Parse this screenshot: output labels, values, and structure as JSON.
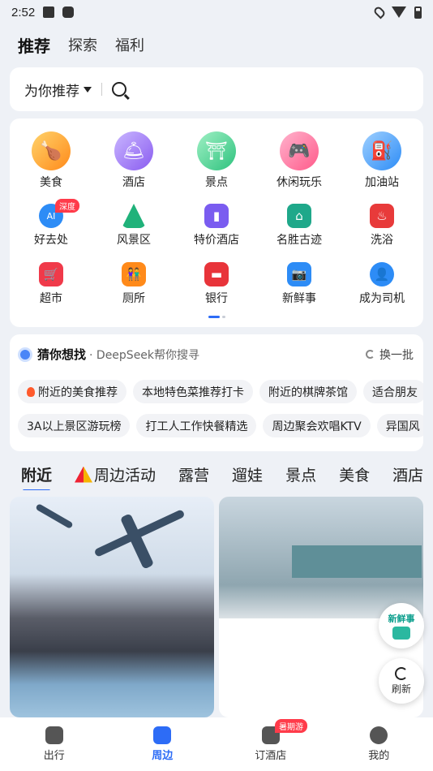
{
  "status": {
    "time": "2:52"
  },
  "top_tabs": [
    {
      "label": "推荐",
      "active": true
    },
    {
      "label": "探索",
      "active": false
    },
    {
      "label": "福利",
      "active": false
    }
  ],
  "search": {
    "selector_label": "为你推荐"
  },
  "grid": {
    "rows": [
      [
        {
          "label": "美食",
          "icon": "food-icon",
          "color": "#ff9a1f"
        },
        {
          "label": "酒店",
          "icon": "hotel-icon",
          "color": "#8a5cf0"
        },
        {
          "label": "景点",
          "icon": "scenic-icon",
          "color": "#2ec27e"
        },
        {
          "label": "休闲玩乐",
          "icon": "gamepad-icon",
          "color": "#ff5a8a"
        },
        {
          "label": "加油站",
          "icon": "gas-station-icon",
          "color": "#2d8cf6"
        }
      ],
      [
        {
          "label": "好去处",
          "icon": "ai-icon",
          "color": "#2d8cf6",
          "badge": "深度"
        },
        {
          "label": "风景区",
          "icon": "mountain-icon",
          "color": "#20b27a"
        },
        {
          "label": "特价酒店",
          "icon": "discount-hotel-icon",
          "color": "#7a5cf0"
        },
        {
          "label": "名胜古迹",
          "icon": "pagoda-icon",
          "color": "#1fa88a"
        },
        {
          "label": "洗浴",
          "icon": "bath-icon",
          "color": "#e83a3a"
        }
      ],
      [
        {
          "label": "超市",
          "icon": "cart-icon",
          "color": "#f03a4a"
        },
        {
          "label": "厕所",
          "icon": "toilet-icon",
          "color": "#ff8a1a"
        },
        {
          "label": "银行",
          "icon": "bank-card-icon",
          "color": "#e8343a"
        },
        {
          "label": "新鲜事",
          "icon": "news-camera-icon",
          "color": "#2d8cf6"
        },
        {
          "label": "成为司机",
          "icon": "driver-icon",
          "color": "#2d8cf6"
        }
      ]
    ]
  },
  "guess": {
    "title": "猜你想找",
    "subtitle": "· DeepSeek帮你搜寻",
    "refresh_label": "换一批",
    "chips_row1": [
      "附近的美食推荐",
      "本地特色菜推荐打卡",
      "附近的棋牌茶馆",
      "适合朋友"
    ],
    "chips_row2": [
      "3A以上景区游玩榜",
      "打工人工作快餐精选",
      "周边聚会欢唱KTV",
      "异国风"
    ]
  },
  "category_tabs": [
    {
      "label": "附近",
      "active": true
    },
    {
      "label": "周边活动",
      "active": false,
      "icon": "tent-icon"
    },
    {
      "label": "露营",
      "active": false
    },
    {
      "label": "遛娃",
      "active": false
    },
    {
      "label": "景点",
      "active": false
    },
    {
      "label": "美食",
      "active": false
    },
    {
      "label": "酒店",
      "active": false
    }
  ],
  "fabs": {
    "news_label": "新鲜事",
    "refresh_label": "刷新"
  },
  "bottom_nav": [
    {
      "label": "出行",
      "icon": "travel-icon",
      "active": false
    },
    {
      "label": "周边",
      "icon": "nearby-icon",
      "active": true
    },
    {
      "label": "订酒店",
      "icon": "hotel-booking-icon",
      "active": false,
      "badge": "暑期游"
    },
    {
      "label": "我的",
      "icon": "profile-icon",
      "active": false
    }
  ]
}
